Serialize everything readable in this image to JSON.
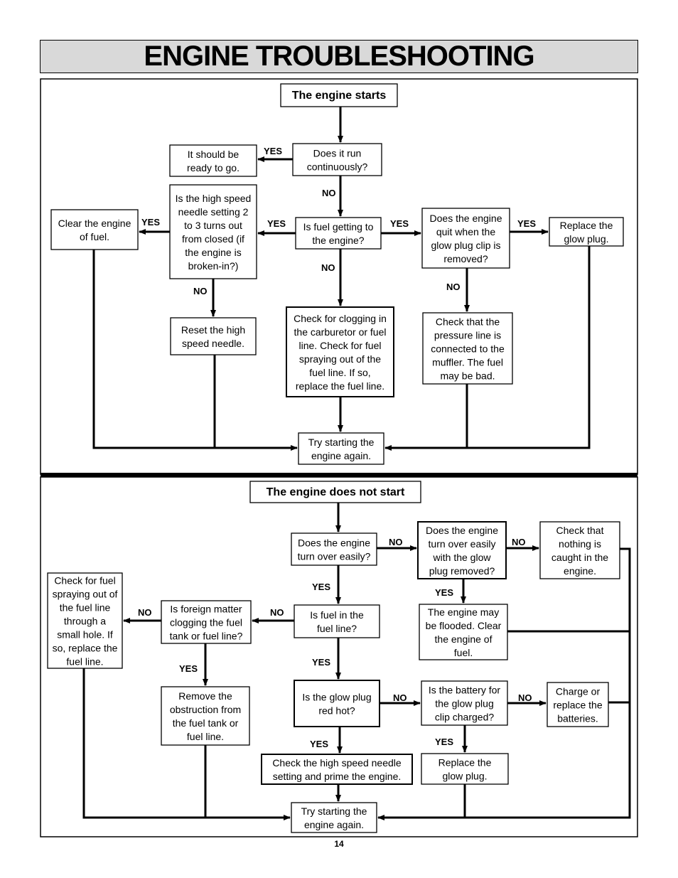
{
  "title": "ENGINE TROUBLESHOOTING",
  "page_number": "14",
  "sections": [
    {
      "id": "starts",
      "header": "The engine starts",
      "nodes": [
        {
          "id": "s1",
          "lines": [
            "Does it run",
            "continuously?"
          ]
        },
        {
          "id": "s2",
          "lines": [
            "It should be",
            "ready to go."
          ]
        },
        {
          "id": "s3",
          "lines": [
            "Is fuel getting to",
            "the engine?"
          ]
        },
        {
          "id": "s4",
          "lines": [
            "Is the high speed",
            "needle setting 2",
            "to 3 turns out",
            "from closed (if",
            "the engine is",
            "broken-in?)"
          ]
        },
        {
          "id": "s5",
          "lines": [
            "Clear the engine",
            "of fuel."
          ]
        },
        {
          "id": "s6",
          "lines": [
            "Reset the high",
            "speed needle."
          ]
        },
        {
          "id": "s7",
          "lines": [
            "Check for clogging in",
            "the carburetor or fuel",
            "line. Check for fuel",
            "spraying out of the",
            "fuel line. If so,",
            "replace the fuel line."
          ]
        },
        {
          "id": "s8",
          "lines": [
            "Does the engine",
            "quit when the",
            "glow plug clip is",
            "removed?"
          ]
        },
        {
          "id": "s9",
          "lines": [
            "Replace the",
            "glow plug."
          ]
        },
        {
          "id": "s10",
          "lines": [
            "Check that the",
            "pressure line is",
            "connected to the",
            "muffler. The fuel",
            "may be bad."
          ]
        },
        {
          "id": "s11",
          "lines": [
            "Try starting the",
            "engine again."
          ]
        }
      ],
      "edge_labels": {
        "s1_yes": "YES",
        "s1_no": "NO",
        "s3_yes_left": "YES",
        "s3_yes_right": "YES",
        "s3_no": "NO",
        "s4_yes": "YES",
        "s4_no": "NO",
        "s8_yes": "YES",
        "s8_no": "NO"
      }
    },
    {
      "id": "not_start",
      "header": "The engine does not start",
      "nodes": [
        {
          "id": "n1",
          "lines": [
            "Does the engine",
            "turn over easily?"
          ]
        },
        {
          "id": "n2",
          "lines": [
            "Does the engine",
            "turn over easily",
            "with the glow",
            "plug removed?"
          ]
        },
        {
          "id": "n3",
          "lines": [
            "Check that",
            "nothing is",
            "caught in the",
            "engine."
          ]
        },
        {
          "id": "n4",
          "lines": [
            "The engine may",
            "be flooded. Clear",
            "the engine of",
            "fuel."
          ]
        },
        {
          "id": "n5",
          "lines": [
            "Is fuel in the",
            "fuel line?"
          ]
        },
        {
          "id": "n6",
          "lines": [
            "Is foreign matter",
            "clogging the fuel",
            "tank or fuel line?"
          ]
        },
        {
          "id": "n7",
          "lines": [
            "Check for fuel",
            "spraying out of",
            "the fuel line",
            "through a",
            "small hole. If",
            "so, replace the",
            "fuel line."
          ]
        },
        {
          "id": "n8",
          "lines": [
            "Remove the",
            "obstruction from",
            "the fuel tank or",
            "fuel line."
          ]
        },
        {
          "id": "n9",
          "lines": [
            "Is the glow plug",
            "red hot?"
          ]
        },
        {
          "id": "n10",
          "lines": [
            "Is the battery for",
            "the glow plug",
            "clip charged?"
          ]
        },
        {
          "id": "n11",
          "lines": [
            "Charge or",
            "replace the",
            "batteries."
          ]
        },
        {
          "id": "n12",
          "lines": [
            "Check the high speed needle",
            "setting and prime the engine."
          ]
        },
        {
          "id": "n13",
          "lines": [
            "Replace the",
            "glow plug."
          ]
        },
        {
          "id": "n14",
          "lines": [
            "Try starting the",
            "engine again."
          ]
        }
      ],
      "edge_labels": {
        "n1_no": "NO",
        "n1_yes": "YES",
        "n2_no": "NO",
        "n2_yes": "YES",
        "n5_no": "NO",
        "n5_yes": "YES",
        "n6_no": "NO",
        "n6_yes": "YES",
        "n9_no": "NO",
        "n9_yes": "YES",
        "n10_no": "NO",
        "n10_yes": "YES"
      }
    }
  ]
}
